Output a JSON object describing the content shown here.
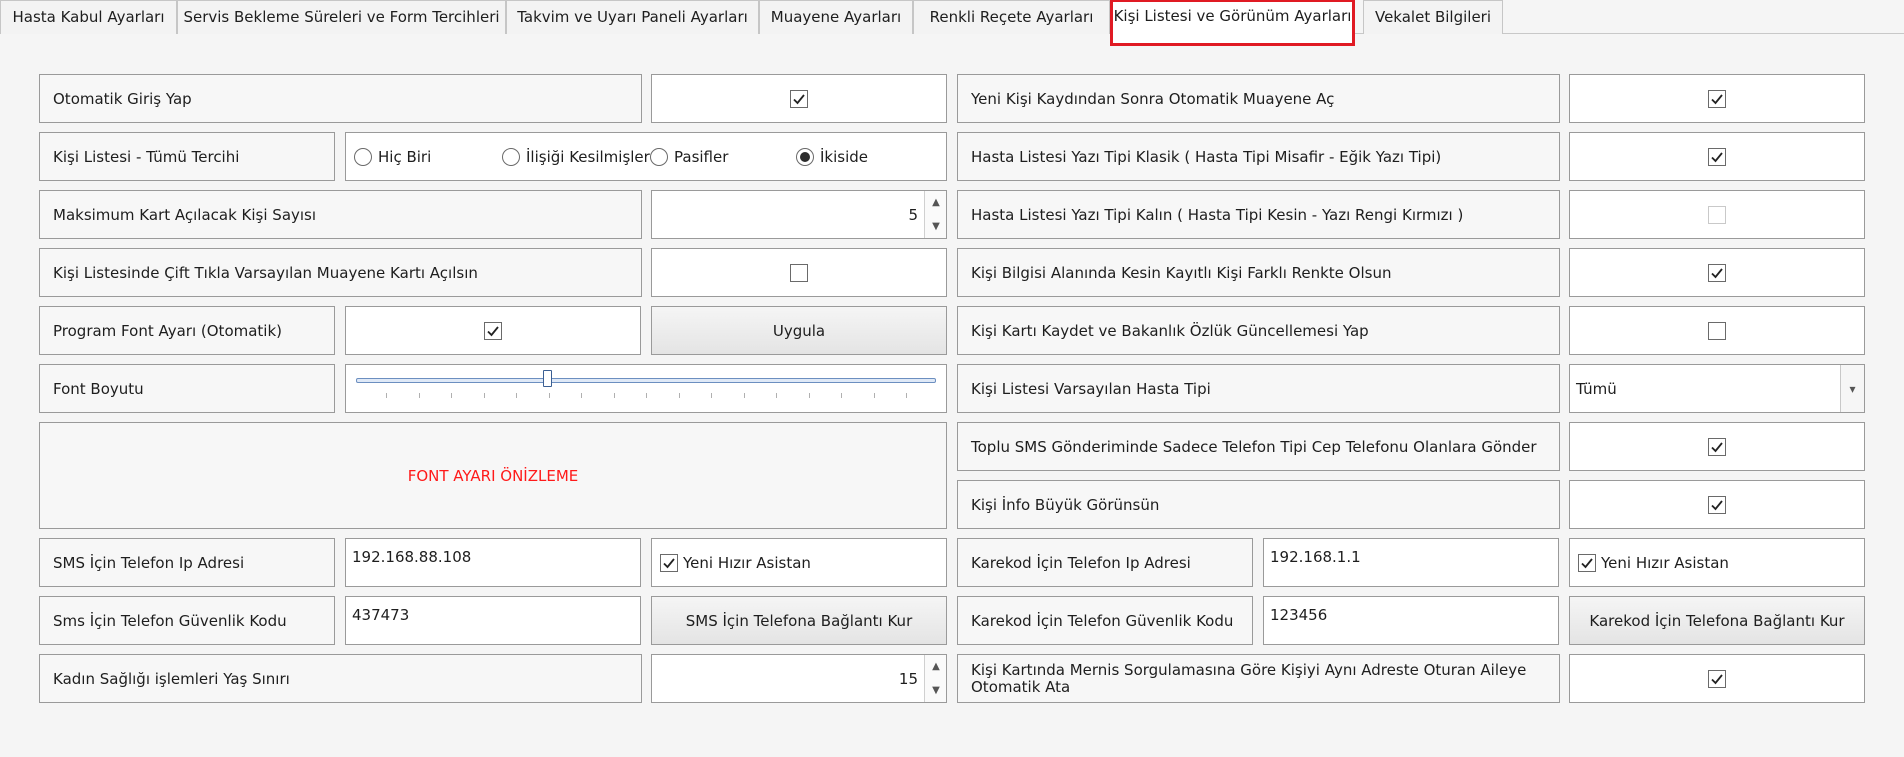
{
  "tabs": [
    {
      "label": "Hasta Kabul Ayarları"
    },
    {
      "label": "Servis Bekleme Süreleri ve Form Tercihleri"
    },
    {
      "label": "Takvim ve Uyarı Paneli Ayarları"
    },
    {
      "label": "Muayene Ayarları"
    },
    {
      "label": "Renkli Reçete Ayarları"
    },
    {
      "label": "Kişi Listesi ve Görünüm Ayarları"
    },
    {
      "label": "Vekalet Bilgileri"
    }
  ],
  "left": {
    "auto_login": {
      "label": "Otomatik Giriş Yap",
      "checked": true
    },
    "person_list_all": {
      "label": "Kişi Listesi - Tümü Tercihi",
      "options": [
        "Hiç Biri",
        "İlişiği Kesilmişler",
        "Pasifler",
        "İkiside"
      ],
      "selected": "İkiside"
    },
    "max_cards": {
      "label": "Maksimum Kart Açılacak Kişi Sayısı",
      "value": "5"
    },
    "double_click": {
      "label": "Kişi Listesinde Çift Tıkla Varsayılan Muayene Kartı Açılsın",
      "checked": false
    },
    "program_font": {
      "label": "Program Font Ayarı (Otomatik)",
      "checked": true,
      "apply_button": "Uygula"
    },
    "font_size": {
      "label": "Font Boyutu",
      "level_fraction": 0.33
    },
    "font_preview": {
      "text": "FONT AYARI ÖNİZLEME",
      "color": "#ff1a1a"
    },
    "sms_ip": {
      "label": "SMS İçin Telefon Ip Adresi",
      "value": "192.168.88.108",
      "assistant_label": "Yeni Hızır Asistan",
      "assistant_checked": true
    },
    "sms_code": {
      "label": "Sms İçin Telefon Güvenlik Kodu",
      "value": "437473",
      "button": "SMS İçin Telefona Bağlantı Kur"
    },
    "women_health": {
      "label": "Kadın Sağlığı işlemleri Yaş Sınırı",
      "value": "15"
    }
  },
  "right": {
    "auto_exam": {
      "label": "Yeni Kişi Kaydından Sonra Otomatik Muayene Aç",
      "checked": true
    },
    "classic_font": {
      "label": "Hasta Listesi Yazı Tipi Klasik ( Hasta Tipi Misafir - Eğik Yazı Tipi)",
      "checked": true
    },
    "bold_font": {
      "label": "Hasta Listesi Yazı Tipi Kalın ( Hasta Tipi Kesin - Yazı Rengi Kırmızı )",
      "checked": false
    },
    "color_diff": {
      "label": "Kişi Bilgisi Alanında Kesin Kayıtlı Kişi Farklı Renkte Olsun",
      "checked": true
    },
    "save_update": {
      "label": "Kişi Kartı Kaydet ve Bakanlık Özlük Güncellemesi Yap",
      "checked": false
    },
    "default_type": {
      "label": "Kişi Listesi Varsayılan Hasta Tipi",
      "value": "Tümü"
    },
    "bulk_sms": {
      "label": "Toplu SMS Gönderiminde Sadece Telefon Tipi Cep Telefonu Olanlara Gönder",
      "checked": true
    },
    "big_info": {
      "label": "Kişi İnfo Büyük Görünsün",
      "checked": true
    },
    "barcode_ip": {
      "label": "Karekod İçin Telefon Ip Adresi",
      "value": "192.168.1.1",
      "assistant_label": "Yeni Hızır Asistan",
      "assistant_checked": true
    },
    "barcode_code": {
      "label": "Karekod İçin Telefon Güvenlik Kodu",
      "value": "123456",
      "button": "Karekod İçin Telefona Bağlantı Kur"
    },
    "mernis": {
      "label": "Kişi Kartında Mernis Sorgulamasına Göre Kişiyi Aynı Adreste Oturan Aileye Otomatik Ata",
      "checked": true
    }
  },
  "colors": {
    "active_tab_border": "#e01a23",
    "preview_text": "#ff1a1a"
  }
}
